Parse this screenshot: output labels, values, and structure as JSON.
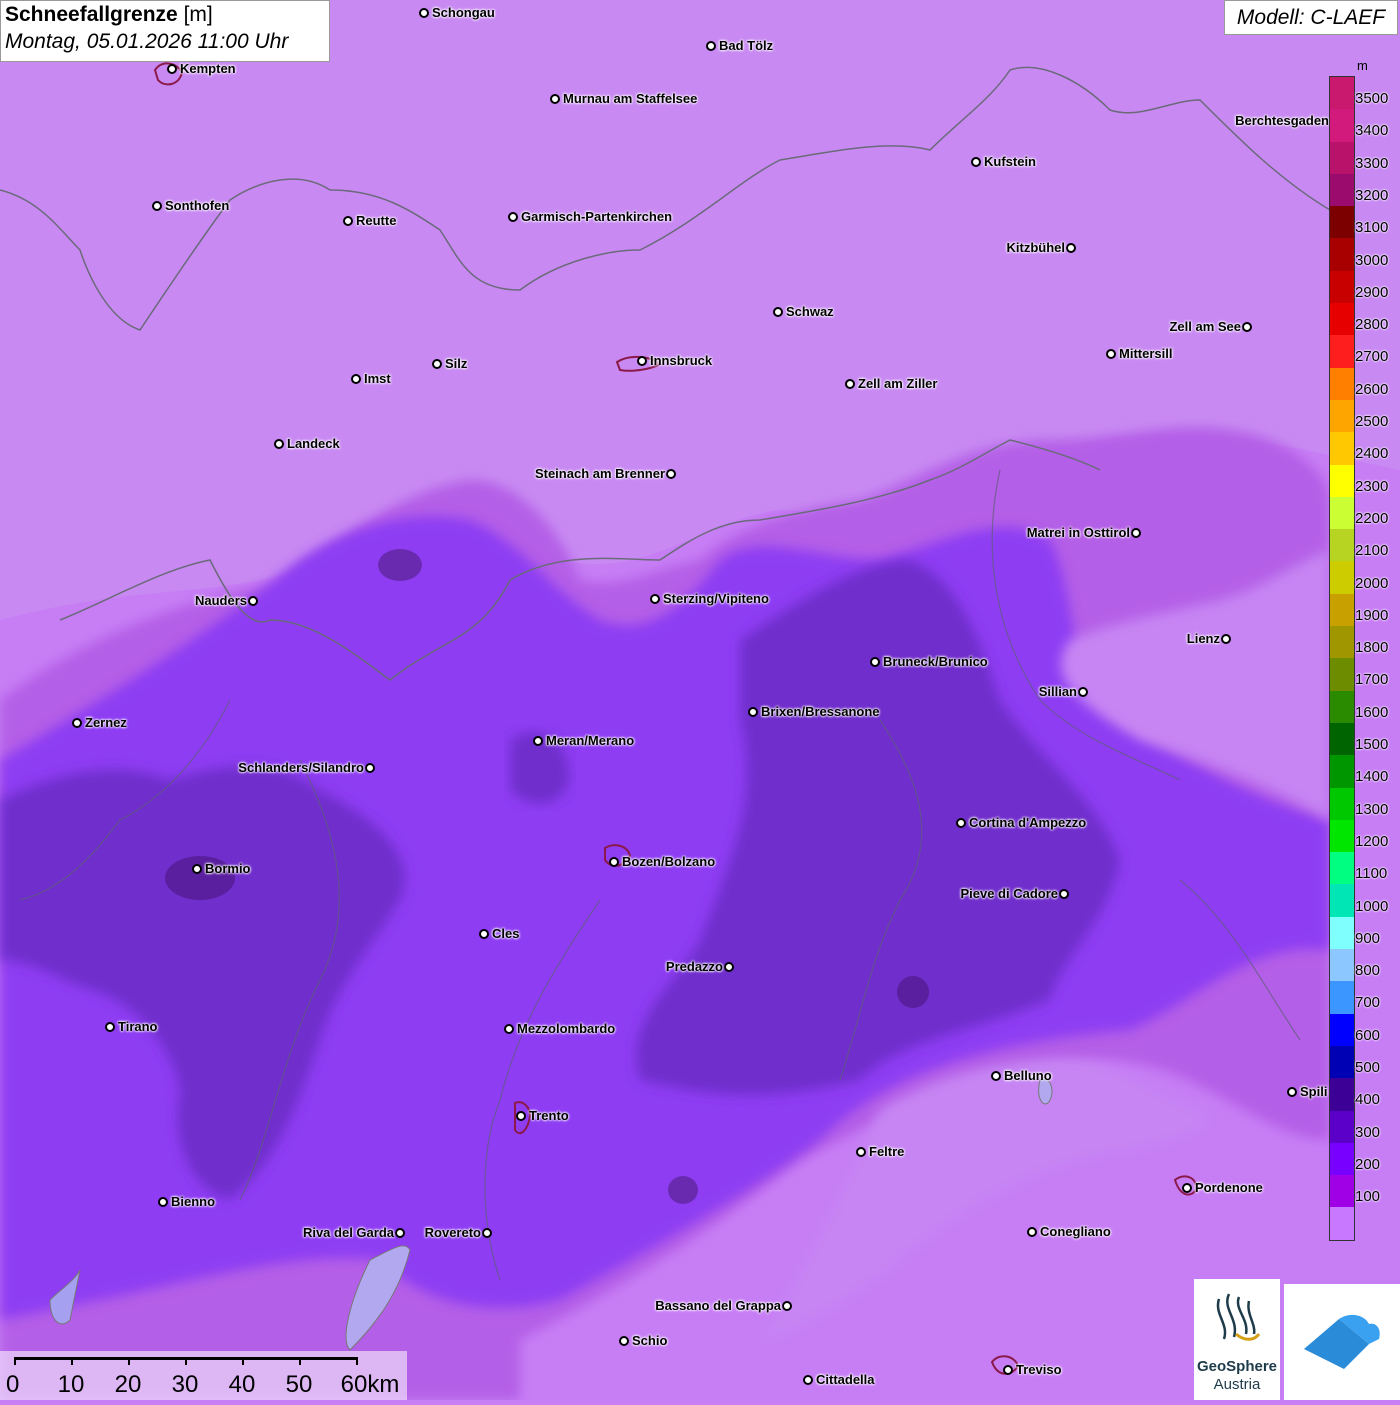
{
  "title": {
    "main_bold": "Schneefallgrenze",
    "unit_bracket": "[m]",
    "date": "Montag, 05.01.2026 11:00 Uhr"
  },
  "model": "Modell: C-LAEF",
  "legend": {
    "unit": "m",
    "colors": [
      "#c8196f",
      "#d11a7b",
      "#b8126b",
      "#9b0b6e",
      "#7d0000",
      "#a80000",
      "#c80000",
      "#e60000",
      "#ff1e1e",
      "#ff8000",
      "#ffa500",
      "#ffc800",
      "#ffff00",
      "#ccff33",
      "#b8d422",
      "#cccc00",
      "#c8a000",
      "#a09600",
      "#6e8c00",
      "#2a8a00",
      "#006400",
      "#009600",
      "#00c800",
      "#00e600",
      "#00ff80",
      "#00e6b4",
      "#80ffff",
      "#8cc8ff",
      "#3c96ff",
      "#0000ff",
      "#0000b4",
      "#3c0096",
      "#5a00c8",
      "#7800ff",
      "#a000e6",
      "#c878ff"
    ],
    "labels": [
      "3500",
      "3400",
      "3300",
      "3200",
      "3100",
      "3000",
      "2900",
      "2800",
      "2700",
      "2600",
      "2500",
      "2400",
      "2300",
      "2200",
      "2100",
      "2000",
      "1900",
      "1800",
      "1700",
      "1600",
      "1500",
      "1400",
      "1300",
      "1200",
      "1100",
      "1000",
      "900",
      "800",
      "700",
      "600",
      "500",
      "400",
      "300",
      "200",
      "100"
    ]
  },
  "cities": [
    {
      "name": "Schongau",
      "label_side": "right"
    },
    {
      "name": "Bad Tölz",
      "label_side": "right"
    },
    {
      "name": "Kempten",
      "label_side": "right"
    },
    {
      "name": "Murnau am Staffelsee",
      "label_side": "right"
    },
    {
      "name": "Berchtesgaden",
      "label_side": "left"
    },
    {
      "name": "Kufstein",
      "label_side": "right"
    },
    {
      "name": "Sonthofen",
      "label_side": "right"
    },
    {
      "name": "Reutte",
      "label_side": "right"
    },
    {
      "name": "Garmisch-Partenkirchen",
      "label_side": "right"
    },
    {
      "name": "Kitzbühel",
      "label_side": "left"
    },
    {
      "name": "Schwaz",
      "label_side": "right"
    },
    {
      "name": "Zell am See",
      "label_side": "left"
    },
    {
      "name": "Innsbruck",
      "label_side": "right"
    },
    {
      "name": "Silz",
      "label_side": "right"
    },
    {
      "name": "Imst",
      "label_side": "right"
    },
    {
      "name": "Mittersill",
      "label_side": "right"
    },
    {
      "name": "Zell am Ziller",
      "label_side": "right"
    },
    {
      "name": "Landeck",
      "label_side": "right"
    },
    {
      "name": "Steinach am Brenner",
      "label_side": "left"
    },
    {
      "name": "Matrei in Osttirol",
      "label_side": "left"
    },
    {
      "name": "Nauders",
      "label_side": "left"
    },
    {
      "name": "Sterzing/Vipiteno",
      "label_side": "right"
    },
    {
      "name": "Lienz",
      "label_side": "left"
    },
    {
      "name": "Bruneck/Brunico",
      "label_side": "right"
    },
    {
      "name": "Sillian",
      "label_side": "left"
    },
    {
      "name": "Brixen/Bressanone",
      "label_side": "right"
    },
    {
      "name": "Zernez",
      "label_side": "right"
    },
    {
      "name": "Meran/Merano",
      "label_side": "right"
    },
    {
      "name": "Schlanders/Silandro",
      "label_side": "left"
    },
    {
      "name": "Cortina d'Ampezzo",
      "label_side": "right"
    },
    {
      "name": "Bozen/Bolzano",
      "label_side": "right"
    },
    {
      "name": "Bormio",
      "label_side": "right"
    },
    {
      "name": "Pieve di Cadore",
      "label_side": "left"
    },
    {
      "name": "Cles",
      "label_side": "right"
    },
    {
      "name": "Predazzo",
      "label_side": "left"
    },
    {
      "name": "Tirano",
      "label_side": "right"
    },
    {
      "name": "Mezzolombardo",
      "label_side": "right"
    },
    {
      "name": "Belluno",
      "label_side": "right"
    },
    {
      "name": "Spili",
      "label_side": "right"
    },
    {
      "name": "Trento",
      "label_side": "right"
    },
    {
      "name": "Feltre",
      "label_side": "right"
    },
    {
      "name": "Pordenone",
      "label_side": "right"
    },
    {
      "name": "Bienno",
      "label_side": "right"
    },
    {
      "name": "Riva del Garda",
      "label_side": "left"
    },
    {
      "name": "Rovereto",
      "label_side": "left"
    },
    {
      "name": "Conegliano",
      "label_side": "right"
    },
    {
      "name": "Bassano del Grappa",
      "label_side": "left"
    },
    {
      "name": "Schio",
      "label_side": "right"
    },
    {
      "name": "Treviso",
      "label_side": "right"
    },
    {
      "name": "Cittadella",
      "label_side": "right"
    }
  ],
  "scale": {
    "labels": [
      "0",
      "10",
      "20",
      "30",
      "40",
      "50",
      "60km"
    ]
  },
  "logos": {
    "geosphere_line1": "GeoSphere",
    "geosphere_line2": "Austria"
  },
  "map_colors": {
    "base": "#c77ef5",
    "band_200": "#b35ce8",
    "band_300": "#8a3ef0",
    "band_400": "#6e2ed0",
    "band_500": "#5a259e"
  }
}
